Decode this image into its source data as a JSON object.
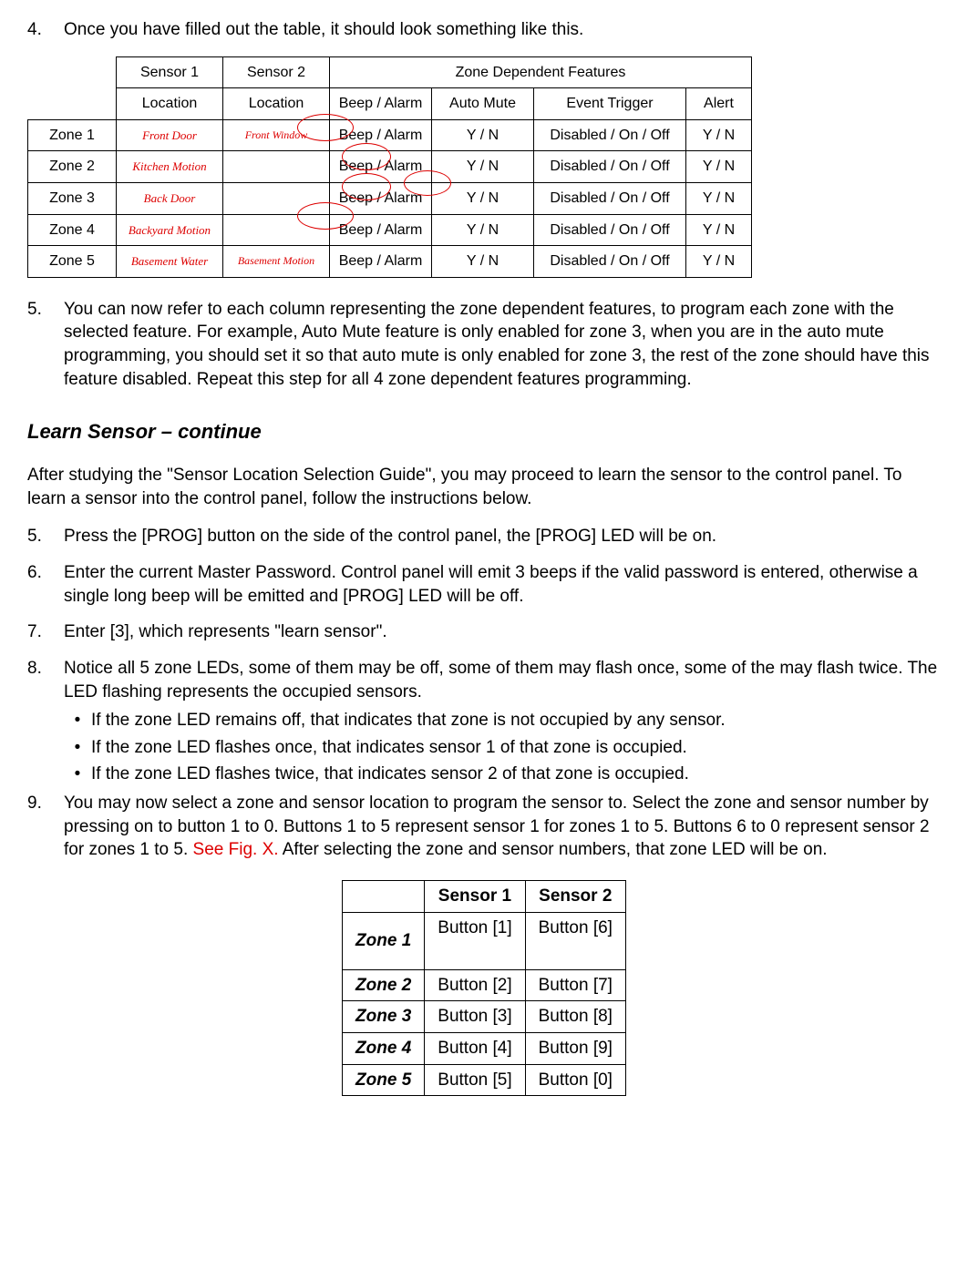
{
  "step4": {
    "num": "4.",
    "text": "Once you have filled out the table, it should look something like this."
  },
  "t1": {
    "hdr_sensor1": "Sensor 1",
    "hdr_sensor2": "Sensor 2",
    "hdr_zdf": "Zone Dependent Features",
    "hdr_loc1": "Location",
    "hdr_loc2": "Location",
    "hdr_beep": "Beep / Alarm",
    "hdr_auto": "Auto Mute",
    "hdr_event": "Event Trigger",
    "hdr_alert": "Alert",
    "rows": [
      {
        "zone": "Zone 1",
        "s1": "Front Door",
        "s2": "Front Window",
        "beep": "Beep / Alarm",
        "auto": "Y / N",
        "event": "Disabled / On / Off",
        "alert": "Y / N"
      },
      {
        "zone": "Zone 2",
        "s1": "Kitchen Motion",
        "s2": "",
        "beep": "Beep / Alarm",
        "auto": "Y / N",
        "event": "Disabled / On / Off",
        "alert": "Y / N"
      },
      {
        "zone": "Zone 3",
        "s1": "Back Door",
        "s2": "",
        "beep": "Beep / Alarm",
        "auto": "Y / N",
        "event": "Disabled / On / Off",
        "alert": "Y / N"
      },
      {
        "zone": "Zone 4",
        "s1": "Backyard Motion",
        "s2": "",
        "beep": "Beep / Alarm",
        "auto": "Y / N",
        "event": "Disabled / On / Off",
        "alert": "Y / N"
      },
      {
        "zone": "Zone 5",
        "s1": "Basement Water",
        "s2": "Basement Motion",
        "beep": "Beep / Alarm",
        "auto": "Y / N",
        "event": "Disabled / On / Off",
        "alert": "Y / N"
      }
    ]
  },
  "step5": {
    "num": "5.",
    "text": "You can now refer to each column representing the zone dependent features, to program each zone with the selected feature.  For example, Auto Mute feature is only enabled for zone 3, when you are in the auto mute programming, you should set it so that auto mute is only enabled for zone 3, the rest of the zone should have this feature disabled.  Repeat this step for all 4 zone dependent features programming."
  },
  "section_heading": "Learn Sensor – continue",
  "para_intro": "After studying the \"Sensor Location Selection Guide\", you may proceed to learn the sensor to the control panel.  To learn a sensor into the control panel, follow the instructions below.",
  "steps2": [
    {
      "num": "5.",
      "text": "Press the [PROG] button on the side of the control panel, the [PROG] LED will be on."
    },
    {
      "num": "6.",
      "text": "Enter the current Master Password.  Control panel will emit 3 beeps if the valid password is entered, otherwise a single long beep will be emitted and [PROG] LED will be off."
    },
    {
      "num": "7.",
      "text": "Enter [3], which represents \"learn sensor\"."
    },
    {
      "num": "8.",
      "text": "Notice all 5 zone LEDs, some of them may be off, some of them may flash once, some of the may flash twice.  The LED flashing represents the occupied sensors."
    }
  ],
  "bullets": [
    "If the zone LED remains off, that indicates that zone is not occupied by any sensor.",
    "If the zone LED flashes once, that indicates sensor 1 of that zone is occupied.",
    "If the zone LED flashes twice, that indicates sensor 2 of that zone is occupied."
  ],
  "step9": {
    "num": "9.",
    "pre": "You may now select a zone and sensor location to program the sensor to.  Select the zone and sensor number by pressing on to button 1 to 0.  Buttons 1 to 5 represent sensor 1 for zones 1 to 5.  Buttons 6 to 0 represent sensor 2 for zones 1 to 5.  ",
    "red": "See Fig. X.",
    "post": "  After selecting the zone and sensor numbers, that zone LED will be on."
  },
  "t2": {
    "hdr_s1": "Sensor 1",
    "hdr_s2": "Sensor 2",
    "rows": [
      {
        "zone": "Zone 1",
        "s1": "Button [1]",
        "s2": "Button [6]"
      },
      {
        "zone": "Zone 2",
        "s1": "Button [2]",
        "s2": "Button [7]"
      },
      {
        "zone": "Zone 3",
        "s1": "Button [3]",
        "s2": "Button [8]"
      },
      {
        "zone": "Zone 4",
        "s1": "Button [4]",
        "s2": "Button [9]"
      },
      {
        "zone": "Zone 5",
        "s1": "Button [5]",
        "s2": "Button [0]"
      }
    ]
  }
}
